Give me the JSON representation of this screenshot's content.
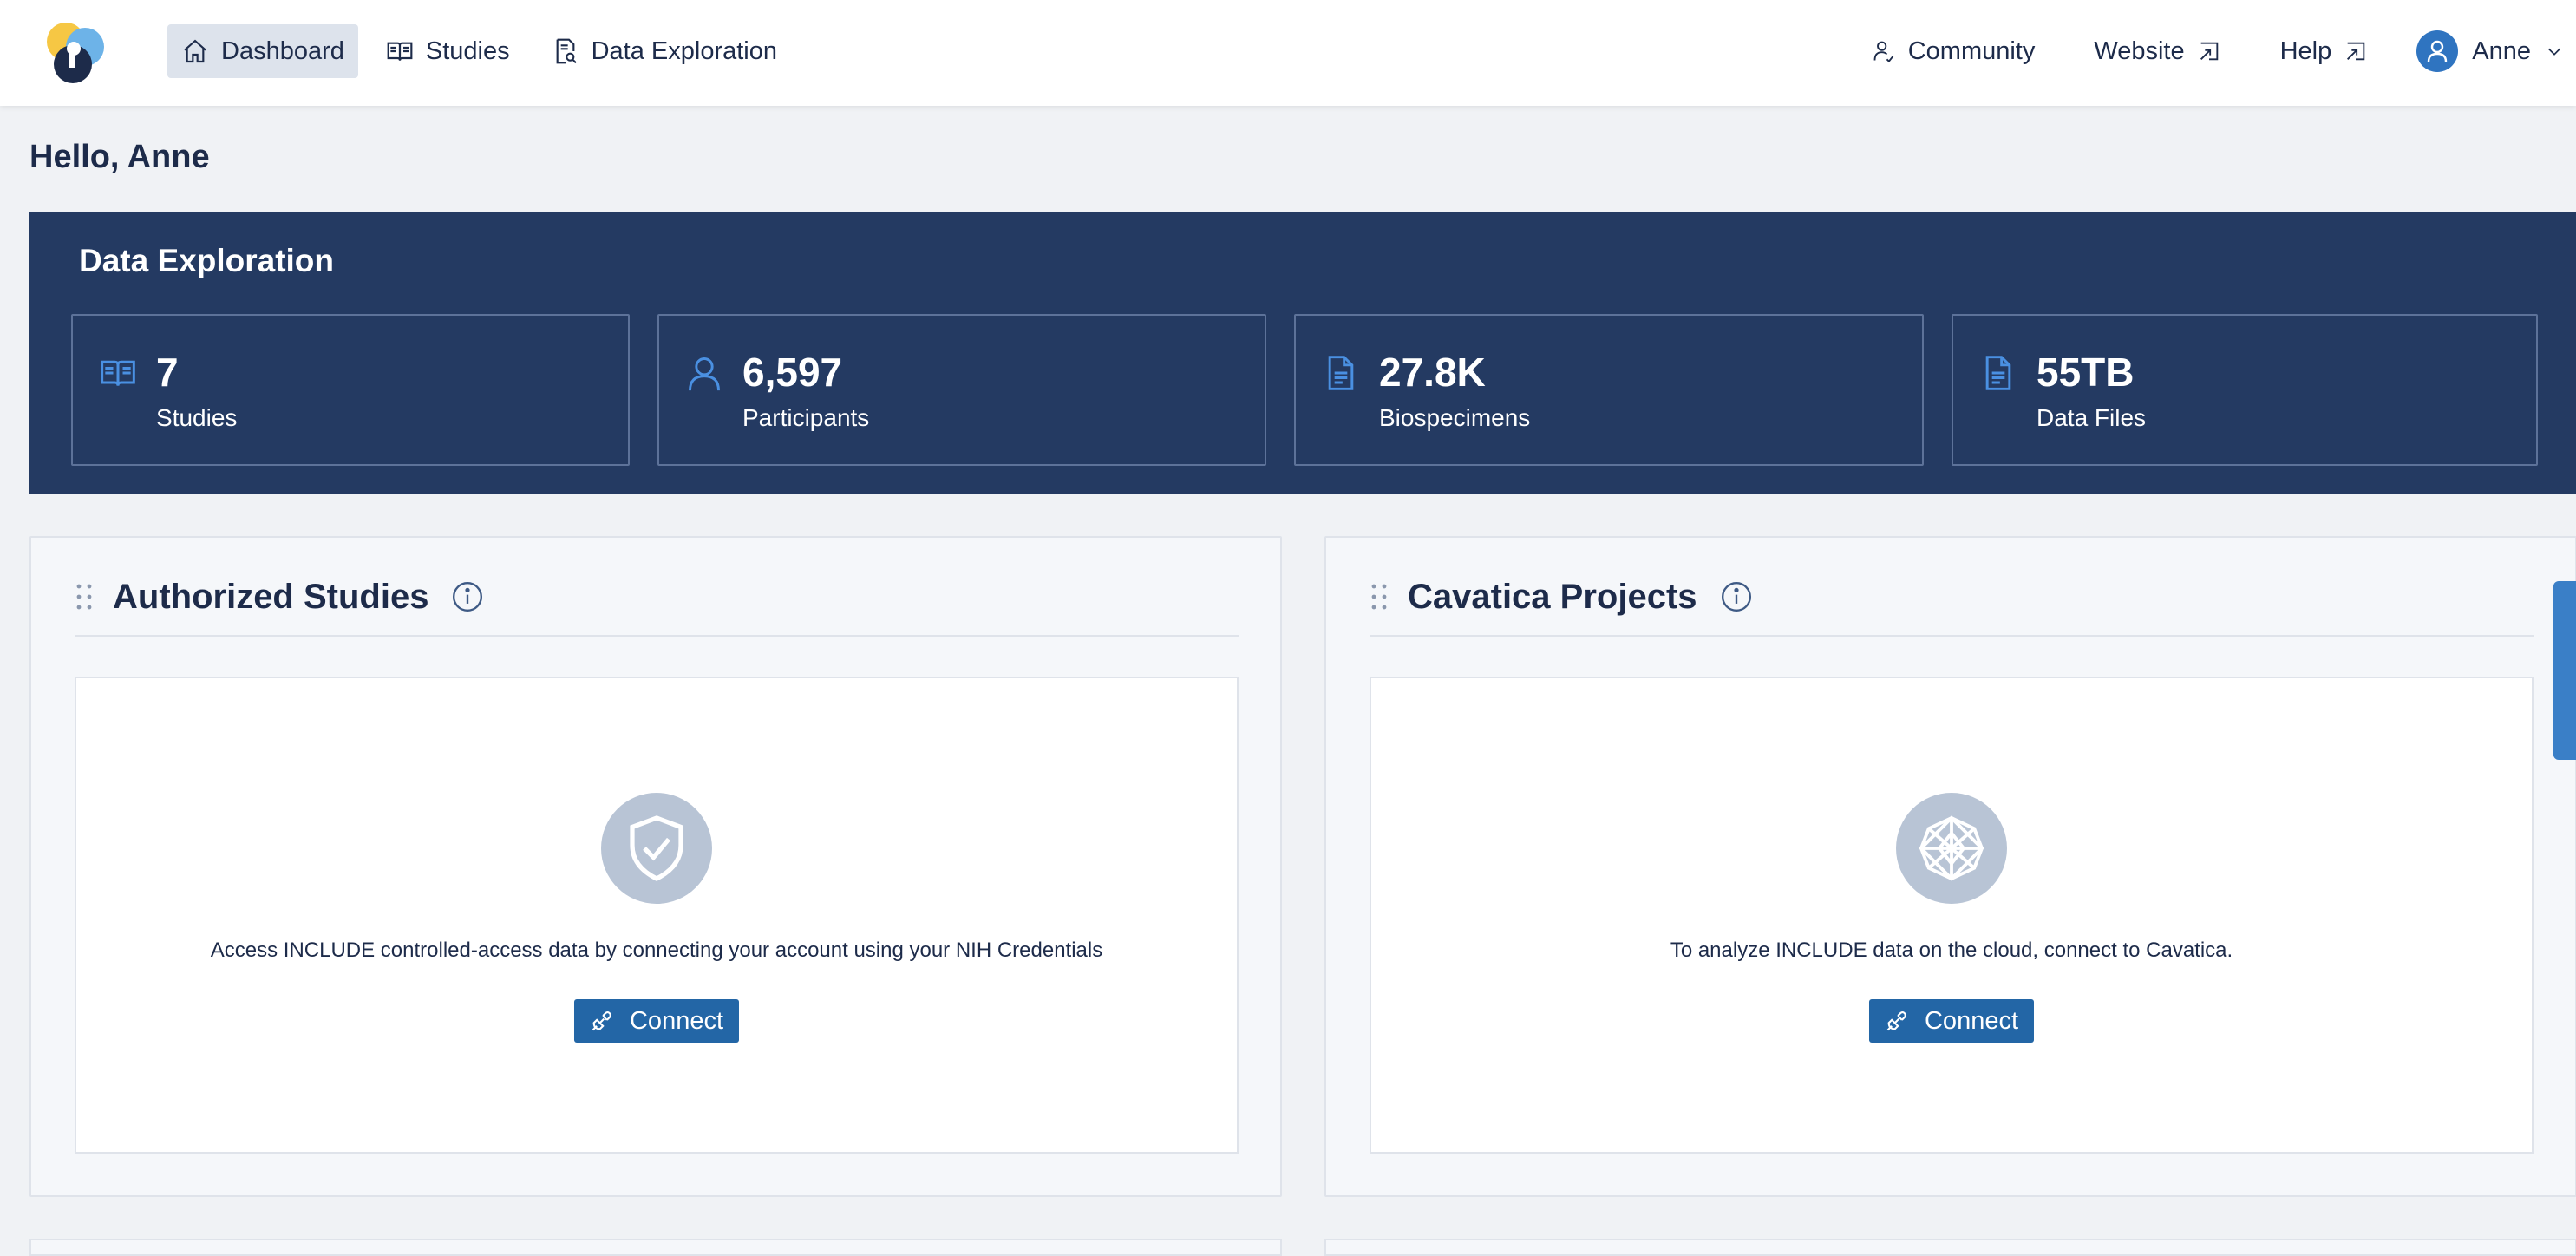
{
  "header": {
    "nav": [
      {
        "label": "Dashboard",
        "icon": "home-icon",
        "active": true
      },
      {
        "label": "Studies",
        "icon": "book-icon",
        "active": false
      },
      {
        "label": "Data Exploration",
        "icon": "file-search-icon",
        "active": false
      }
    ],
    "right_nav": {
      "community": "Community",
      "website": "Website",
      "help": "Help",
      "user": "Anne"
    }
  },
  "greeting": "Hello, Anne",
  "data_exploration": {
    "title": "Data Exploration",
    "stats": [
      {
        "value": "7",
        "label": "Studies",
        "icon": "book-icon"
      },
      {
        "value": "6,597",
        "label": "Participants",
        "icon": "user-icon"
      },
      {
        "value": "27.8K",
        "label": "Biospecimens",
        "icon": "file-icon"
      },
      {
        "value": "55TB",
        "label": "Data Files",
        "icon": "file-icon"
      }
    ]
  },
  "cards": {
    "authorized_studies": {
      "title": "Authorized Studies",
      "text": "Access INCLUDE controlled-access data by connecting your account using your NIH Credentials",
      "button": "Connect",
      "icon": "shield-check-icon"
    },
    "cavatica_projects": {
      "title": "Cavatica Projects",
      "text": "To analyze INCLUDE data on the cloud, connect to Cavatica.",
      "button": "Connect",
      "icon": "cavatica-network-icon"
    }
  },
  "colors": {
    "banner": "#243a62",
    "accent": "#2366a6",
    "stat_icon": "#4a90e2",
    "page_bg": "#f0f2f5"
  }
}
